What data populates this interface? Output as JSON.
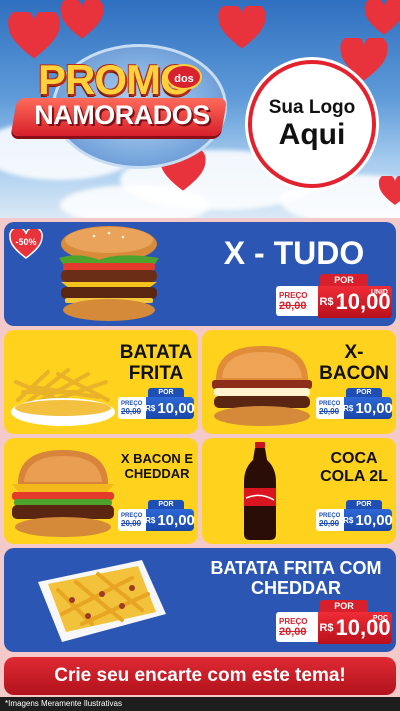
{
  "header": {
    "promo_word": "PROMO",
    "promo_dos": "dos",
    "promo_namorados": "NAMORADOS",
    "logo_line1": "Sua Logo",
    "logo_line2": "Aqui"
  },
  "discount_badge": "-50%",
  "products": [
    {
      "title": "X - TUDO",
      "price_label": "POR",
      "old_label": "PREÇO",
      "old_price": "20,00",
      "currency": "R$",
      "new_price": "10,00",
      "unit": "UNID"
    },
    {
      "title": "BATATA FRITA",
      "price_label": "POR",
      "old_label": "PREÇO",
      "old_price": "20,00",
      "currency": "R$",
      "new_price": "10,00"
    },
    {
      "title": "X-BACON",
      "price_label": "POR",
      "old_label": "PREÇO",
      "old_price": "20,00",
      "currency": "R$",
      "new_price": "10,00"
    },
    {
      "title": "X BACON E CHEDDAR",
      "price_label": "POR",
      "old_label": "PREÇO",
      "old_price": "20,00",
      "currency": "R$",
      "new_price": "10,00"
    },
    {
      "title": "COCA COLA 2L",
      "price_label": "POR",
      "old_label": "PREÇO",
      "old_price": "20,00",
      "currency": "R$",
      "new_price": "10,00"
    },
    {
      "title": "BATATA FRITA COM CHEDDAR",
      "price_label": "POR",
      "old_label": "PREÇO",
      "old_price": "20,00",
      "currency": "R$",
      "new_price": "10,00",
      "unit": "POÇ"
    }
  ],
  "footer": {
    "cta": "Crie seu encarte com este tema!",
    "disclaimer": "*Imagens Meramente Ilustrativas"
  },
  "colors": {
    "blue": "#2c56b3",
    "yellow": "#ffd21d",
    "red": "#d8202c"
  }
}
